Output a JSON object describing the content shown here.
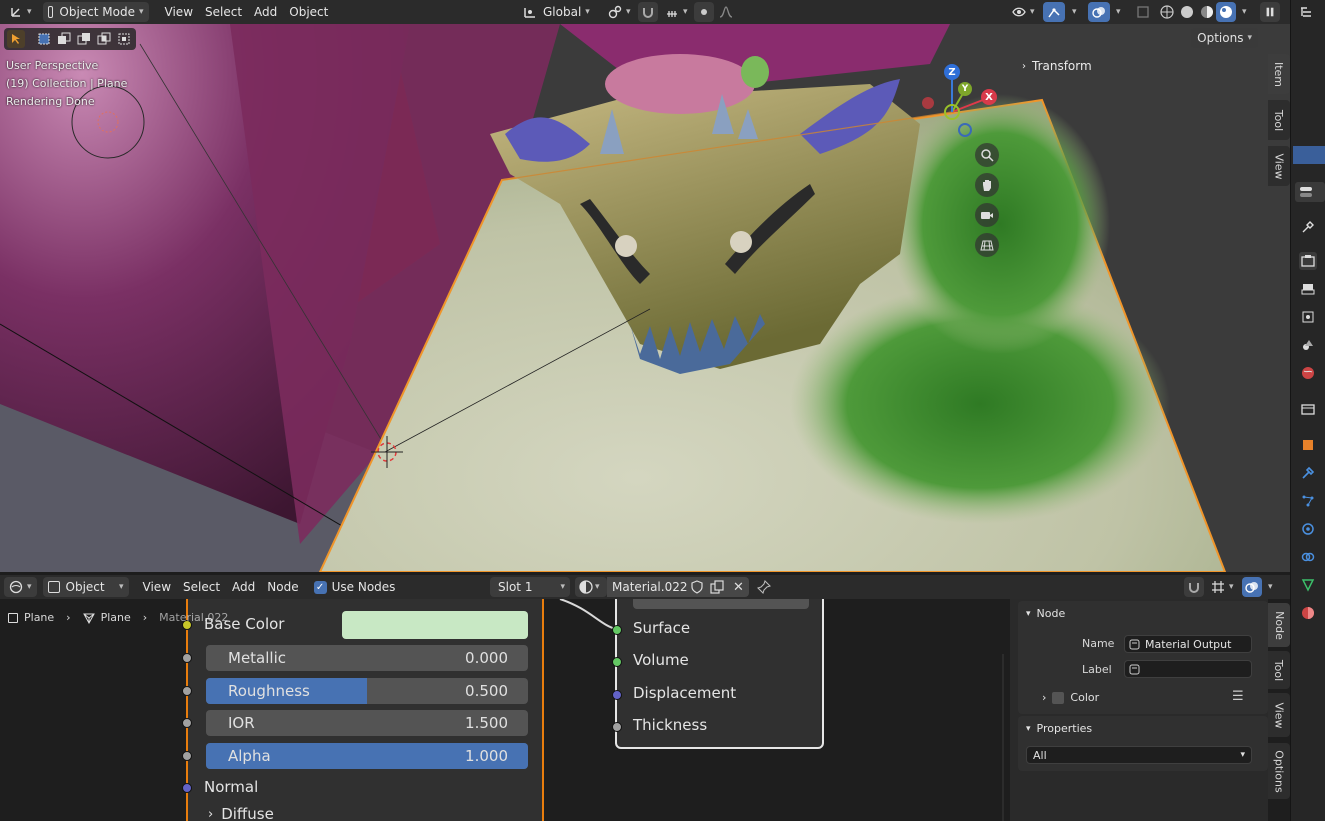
{
  "viewport_header": {
    "mode": "Object Mode",
    "menus": [
      "View",
      "Select",
      "Add",
      "Object"
    ],
    "orientation": "Global",
    "options_label": "Options"
  },
  "viewport": {
    "info_lines": [
      "User Perspective",
      "(19) Collection | Plane",
      "Rendering Done"
    ],
    "transform_label": "Transform",
    "gizmo_axes": {
      "z": "Z",
      "y": "Y",
      "x": "X"
    },
    "side_tabs": [
      "Item",
      "Tool",
      "View"
    ],
    "colors": {
      "plane_light": "#c4c8a8",
      "plane_green": "#3f8a2c",
      "wall_purple": "#7a2e5c",
      "wall_red": "#8a1c14",
      "selection_outline": "#f0952a"
    }
  },
  "node_header": {
    "type": "Object",
    "menus": [
      "View",
      "Select",
      "Add",
      "Node"
    ],
    "use_nodes_label": "Use Nodes",
    "use_nodes_checked": true,
    "slot": "Slot 1",
    "material": "Material.022"
  },
  "breadcrumb": [
    "Plane",
    "Plane",
    "Material.022"
  ],
  "bsdf": {
    "base_color_label": "Base Color",
    "base_color": "#c8e8c4",
    "metallic": {
      "label": "Metallic",
      "value": "0.000",
      "fill": 0
    },
    "roughness": {
      "label": "Roughness",
      "value": "0.500",
      "fill": 0.5
    },
    "ior": {
      "label": "IOR",
      "value": "1.500",
      "fill": 0
    },
    "alpha": {
      "label": "Alpha",
      "value": "1.000",
      "fill": 1
    },
    "normal_label": "Normal",
    "diffuse_label": "Diffuse"
  },
  "output_node": {
    "sockets": [
      "Surface",
      "Volume",
      "Displacement",
      "Thickness"
    ]
  },
  "n_panel": {
    "node_section": "Node",
    "name_label": "Name",
    "name_value": "Material Output",
    "label_label": "Label",
    "label_value": "",
    "color_label": "Color",
    "properties_section": "Properties",
    "properties_value": "All",
    "side_tabs": [
      "Node",
      "Tool",
      "View",
      "Options"
    ]
  }
}
